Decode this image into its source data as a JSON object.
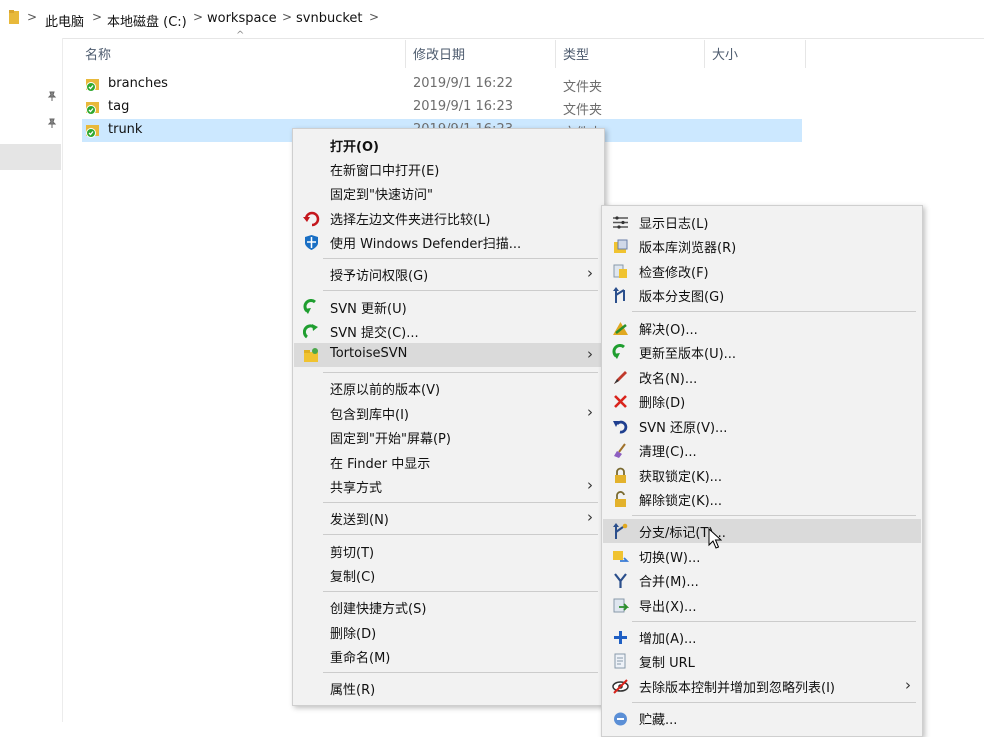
{
  "address": {
    "crumbs": [
      "此电脑",
      "本地磁盘 (C:)",
      "workspace",
      "svnbucket"
    ],
    "separator": ">"
  },
  "nav": {
    "partial_label": "ce"
  },
  "columns": {
    "name": "名称",
    "modified": "修改日期",
    "type": "类型",
    "size": "大小"
  },
  "files": [
    {
      "name": "branches",
      "date": "2019/9/1 16:22",
      "type": "文件夹",
      "selected": false
    },
    {
      "name": "tag",
      "date": "2019/9/1 16:23",
      "type": "文件夹",
      "selected": false
    },
    {
      "name": "trunk",
      "date": "2019/9/1 16:23",
      "type": "文件夹",
      "selected": true
    }
  ],
  "context_menu": {
    "items": [
      {
        "label": "打开(O)",
        "bold": true
      },
      {
        "label": "在新窗口中打开(E)"
      },
      {
        "label": "固定到\"快速访问\""
      },
      {
        "label": "选择左边文件夹进行比较(L)",
        "icon": "compare-icon"
      },
      {
        "label": "使用 Windows Defender扫描...",
        "icon": "defender-icon"
      },
      {
        "label": "授予访问权限(G)",
        "submenu": true
      },
      {
        "label": "SVN 更新(U)",
        "icon": "svn-update-icon"
      },
      {
        "label": "SVN 提交(C)...",
        "icon": "svn-commit-icon"
      },
      {
        "label": "TortoiseSVN",
        "icon": "tortoisesvn-icon",
        "submenu": true,
        "highlighted": true
      },
      {
        "label": "还原以前的版本(V)"
      },
      {
        "label": "包含到库中(I)",
        "submenu": true
      },
      {
        "label": "固定到\"开始\"屏幕(P)"
      },
      {
        "label": "在 Finder 中显示"
      },
      {
        "label": "共享方式",
        "submenu": true
      },
      {
        "label": "发送到(N)",
        "submenu": true
      },
      {
        "label": "剪切(T)"
      },
      {
        "label": "复制(C)"
      },
      {
        "label": "创建快捷方式(S)"
      },
      {
        "label": "删除(D)"
      },
      {
        "label": "重命名(M)"
      },
      {
        "label": "属性(R)"
      }
    ]
  },
  "svn_menu": {
    "items": [
      {
        "label": "显示日志(L)",
        "icon": "log-icon"
      },
      {
        "label": "版本库浏览器(R)",
        "icon": "repo-browser-icon"
      },
      {
        "label": "检查修改(F)",
        "icon": "check-modifications-icon"
      },
      {
        "label": "版本分支图(G)",
        "icon": "revision-graph-icon"
      },
      {
        "label": "解决(O)...",
        "icon": "resolve-icon"
      },
      {
        "label": "更新至版本(U)...",
        "icon": "update-to-revision-icon"
      },
      {
        "label": "改名(N)...",
        "icon": "rename-icon"
      },
      {
        "label": "删除(D)",
        "icon": "delete-icon"
      },
      {
        "label": "SVN 还原(V)...",
        "icon": "revert-icon"
      },
      {
        "label": "清理(C)...",
        "icon": "cleanup-icon"
      },
      {
        "label": "获取锁定(K)...",
        "icon": "lock-icon"
      },
      {
        "label": "解除锁定(K)...",
        "icon": "unlock-icon"
      },
      {
        "label": "分支/标记(T)...",
        "icon": "branch-tag-icon",
        "highlighted": true
      },
      {
        "label": "切换(W)...",
        "icon": "switch-icon"
      },
      {
        "label": "合并(M)...",
        "icon": "merge-icon"
      },
      {
        "label": "导出(X)...",
        "icon": "export-icon"
      },
      {
        "label": "增加(A)...",
        "icon": "add-icon"
      },
      {
        "label": "复制 URL",
        "icon": "copy-url-icon"
      },
      {
        "label": "去除版本控制并增加到忽略列表(I)",
        "icon": "ignore-icon",
        "submenu": true
      },
      {
        "label": "贮藏...",
        "icon": "shelve-icon"
      }
    ]
  },
  "colors": {
    "selection": "#cce8ff",
    "menu_bg": "#f2f2f2",
    "menu_highlight": "#dadada"
  }
}
